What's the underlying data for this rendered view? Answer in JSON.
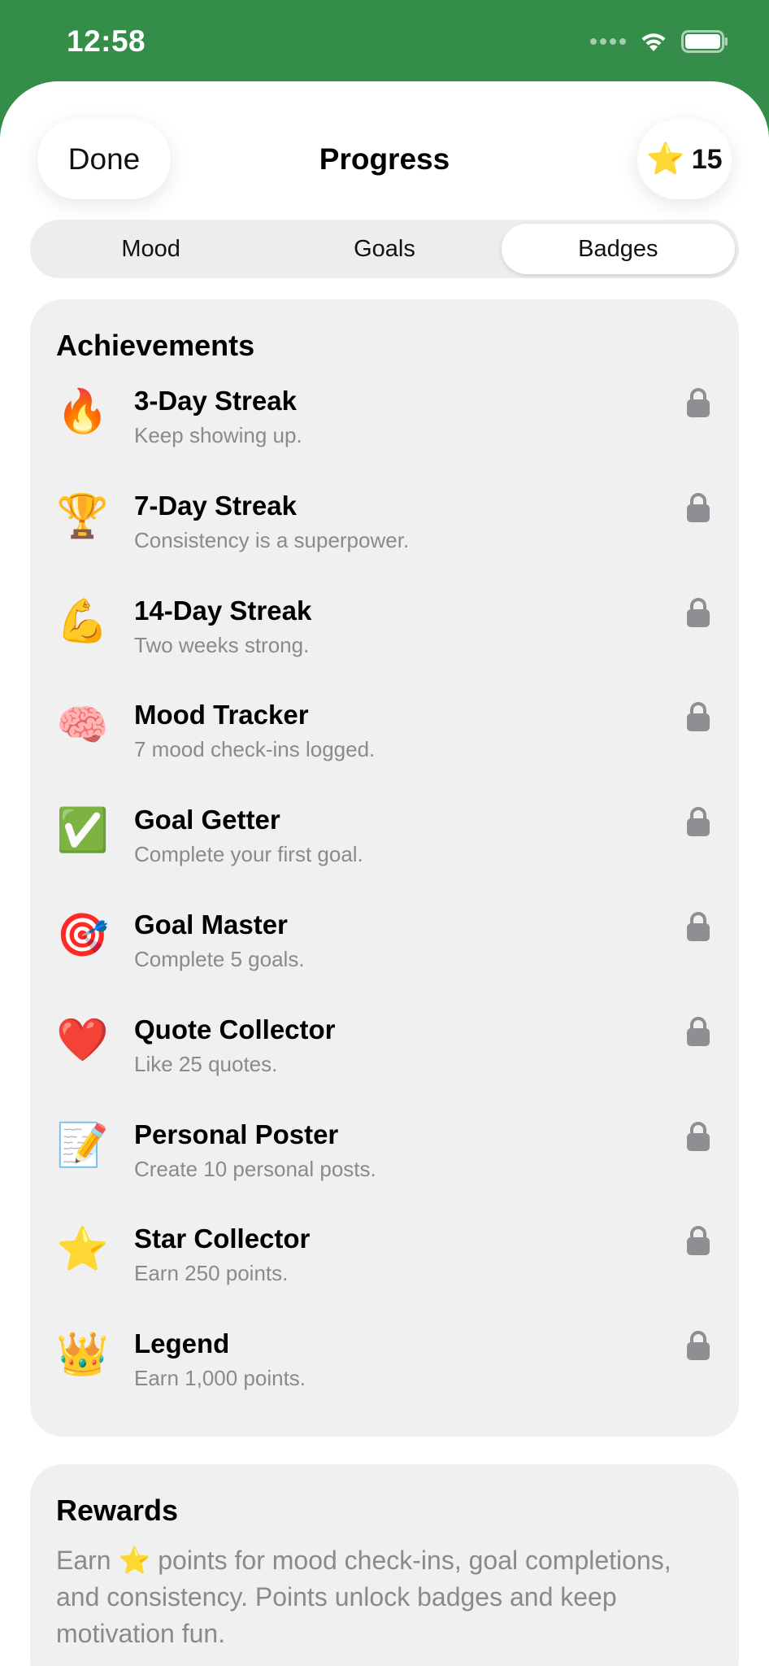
{
  "status_bar": {
    "time": "12:58"
  },
  "header": {
    "done_label": "Done",
    "title": "Progress",
    "points_star": "⭐",
    "points_value": "15"
  },
  "tabs": [
    {
      "label": "Mood",
      "active": false
    },
    {
      "label": "Goals",
      "active": false
    },
    {
      "label": "Badges",
      "active": true
    }
  ],
  "achievements": {
    "title": "Achievements",
    "items": [
      {
        "emoji": "🔥",
        "title": "3-Day Streak",
        "desc": "Keep showing up.",
        "locked": true
      },
      {
        "emoji": "🏆",
        "title": "7-Day Streak",
        "desc": "Consistency is a superpower.",
        "locked": true
      },
      {
        "emoji": "💪",
        "title": "14-Day Streak",
        "desc": "Two weeks strong.",
        "locked": true
      },
      {
        "emoji": "🧠",
        "title": "Mood Tracker",
        "desc": "7 mood check-ins logged.",
        "locked": true
      },
      {
        "emoji": "✅",
        "title": "Goal Getter",
        "desc": "Complete your first goal.",
        "locked": true
      },
      {
        "emoji": "🎯",
        "title": "Goal Master",
        "desc": "Complete 5 goals.",
        "locked": true
      },
      {
        "emoji": "❤️",
        "title": "Quote Collector",
        "desc": "Like 25 quotes.",
        "locked": true
      },
      {
        "emoji": "📝",
        "title": "Personal Poster",
        "desc": "Create 10 personal posts.",
        "locked": true
      },
      {
        "emoji": "⭐",
        "title": "Star Collector",
        "desc": "Earn 250 points.",
        "locked": true
      },
      {
        "emoji": "👑",
        "title": "Legend",
        "desc": "Earn 1,000 points.",
        "locked": true
      }
    ]
  },
  "rewards": {
    "title": "Rewards",
    "text": "Earn ⭐ points for mood check-ins, goal completions, and consistency. Points unlock badges and keep motivation fun."
  },
  "colors": {
    "header_green": "#348e49",
    "card_bg": "#f0f0f0",
    "secondary_text": "#8a8a8e",
    "lock_gray": "#8e8e93"
  }
}
